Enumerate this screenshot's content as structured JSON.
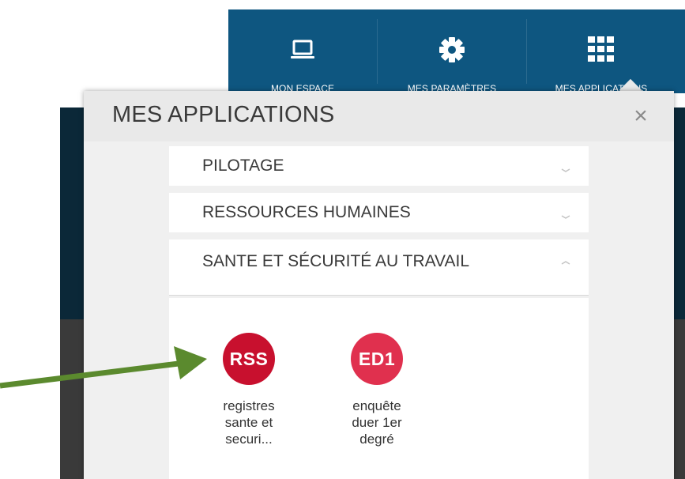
{
  "colors": {
    "nav_bg": "#0e5680",
    "dark_band": "#0b2838",
    "popup_bg": "#f0f0f0",
    "app_rss": "#c8102e",
    "app_ed1": "#e0304e",
    "arrow": "#5b8a2e"
  },
  "topnav": {
    "items": [
      {
        "label": "MON ESPACE",
        "icon": "laptop-icon"
      },
      {
        "label": "MES PARAMÈTRES",
        "icon": "gear-icon"
      },
      {
        "label": "MES APPLICATIONS",
        "icon": "grid-icon"
      }
    ]
  },
  "popup": {
    "title": "MES APPLICATIONS",
    "close_symbol": "×",
    "sections": [
      {
        "label": "PILOTAGE",
        "state": "collapsed"
      },
      {
        "label": "RESSOURCES HUMAINES",
        "state": "collapsed"
      },
      {
        "label": "SANTE ET SÉCURITÉ AU TRAVAIL",
        "state": "expanded"
      }
    ],
    "apps": [
      {
        "badge": "RSS",
        "name_lines": [
          "registres",
          "sante et",
          "securi..."
        ],
        "color": "#c8102e"
      },
      {
        "badge": "ED1",
        "name_lines": [
          "enquête",
          "duer 1er",
          "degré"
        ],
        "color": "#e0304e"
      }
    ]
  }
}
